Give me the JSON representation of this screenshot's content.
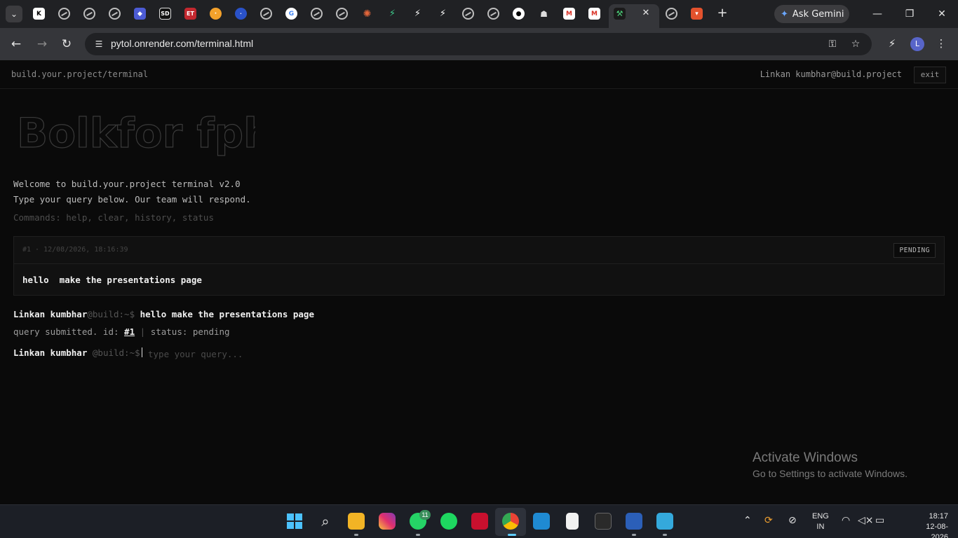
{
  "browser": {
    "ask_gemini_label": "Ask Gemini",
    "url": "pytol.onrender.com/terminal.html",
    "avatar_initial": "L"
  },
  "header": {
    "breadcrumb": "build.your.project/terminal",
    "user_email": "Linkan kumbhar@build.project",
    "exit_label": "exit"
  },
  "terminal": {
    "banner_text": "Bolkfor fphn",
    "welcome": "Welcome to build.your.project terminal v2.0",
    "instructions": "Type your query below. Our team will respond.",
    "commands_hint": "Commands: help, clear, history, status",
    "query_card": {
      "meta": "#1 · 12/08/2026, 18:16:39",
      "status_badge": "PENDING",
      "body": "hello  make the presentations page"
    },
    "history_line": {
      "user": "Linkan kumbhar",
      "host": "@build:~$",
      "command": "hello make the presentations page"
    },
    "submitted_line": {
      "prefix": "query submitted. id: ",
      "id": "#1",
      "separator": " | ",
      "status": "status: pending"
    },
    "prompt": {
      "user": "Linkan kumbhar",
      "host": "@build:~$",
      "input_value": "",
      "placeholder": "type your query..."
    }
  },
  "watermark": {
    "title": "Activate Windows",
    "subtitle": "Go to Settings to activate Windows."
  },
  "taskbar": {
    "whatsapp_badge": "11",
    "lang_top": "ENG",
    "lang_bottom": "IN",
    "time": "18:17",
    "date": "12-08-2026"
  },
  "colors": {
    "page_bg": "#0a0a0a",
    "card_bg": "#111111",
    "text": "#f0f0f0",
    "muted": "#555555"
  }
}
